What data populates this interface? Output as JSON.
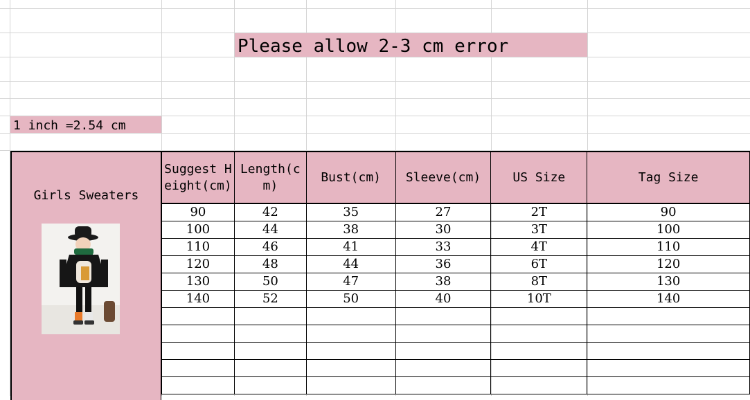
{
  "banner": {
    "text": "Please allow 2-3 cm error"
  },
  "conversion": {
    "text": "1 inch =2.54 cm"
  },
  "product": {
    "title": "Girls Sweaters"
  },
  "table": {
    "headers": [
      "Suggest Height(cm)",
      "Length(cm)",
      "Bust(cm)",
      "Sleeve(cm)",
      "US Size",
      "Tag Size"
    ],
    "rows": [
      [
        "90",
        "42",
        "35",
        "27",
        "2T",
        "90"
      ],
      [
        "100",
        "44",
        "38",
        "30",
        "3T",
        "100"
      ],
      [
        "110",
        "46",
        "41",
        "33",
        "4T",
        "110"
      ],
      [
        "120",
        "48",
        "44",
        "36",
        "6T",
        "120"
      ],
      [
        "130",
        "50",
        "47",
        "38",
        "8T",
        "130"
      ],
      [
        "140",
        "52",
        "50",
        "40",
        "10T",
        "140"
      ],
      [
        "",
        "",
        "",
        "",
        "",
        ""
      ],
      [
        "",
        "",
        "",
        "",
        "",
        ""
      ],
      [
        "",
        "",
        "",
        "",
        "",
        ""
      ],
      [
        "",
        "",
        "",
        "",
        "",
        ""
      ],
      [
        "",
        "",
        "",
        "",
        "",
        ""
      ]
    ]
  },
  "colors": {
    "header_fill": "#e6b6c2",
    "gridline": "#d4d4d4",
    "border": "#000000"
  }
}
